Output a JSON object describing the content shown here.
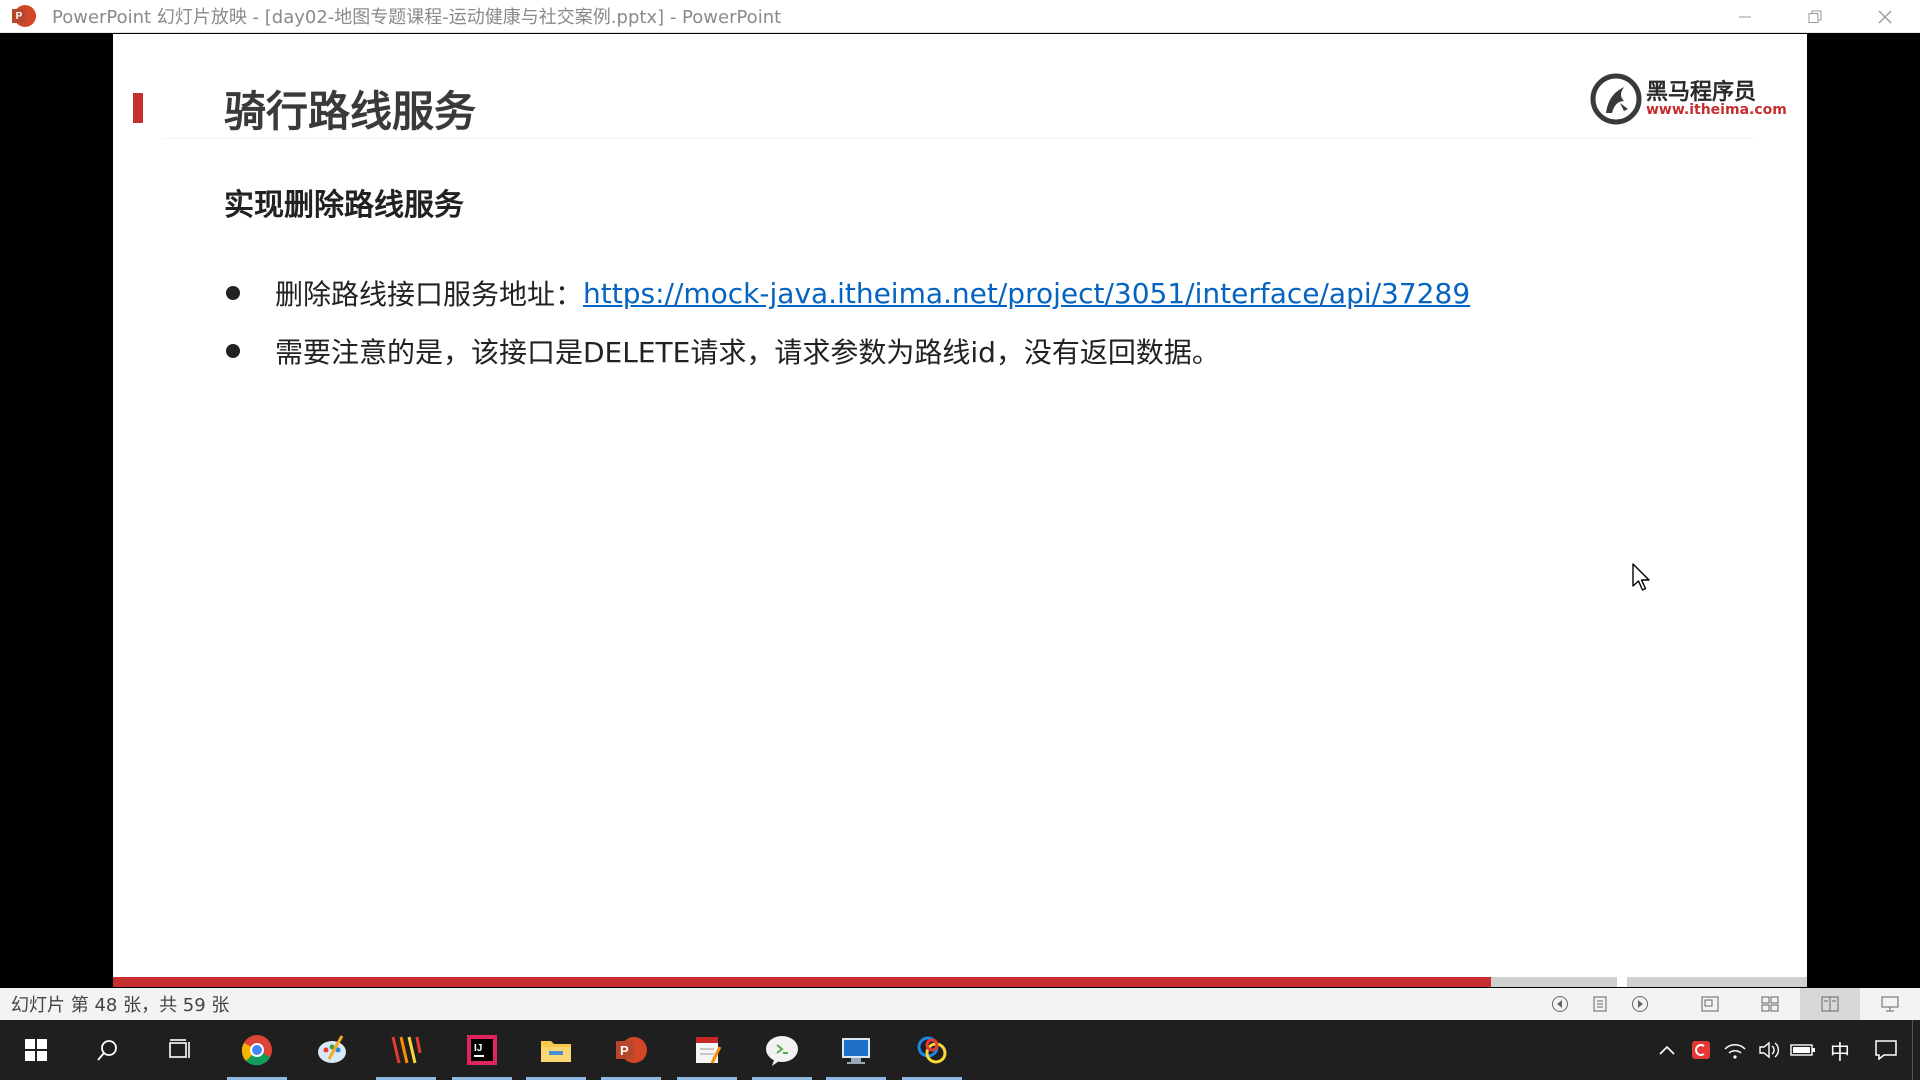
{
  "window": {
    "title": "PowerPoint 幻灯片放映 - [day02-地图专题课程-运动健康与社交案例.pptx] - PowerPoint",
    "app_icon": "powerpoint-icon",
    "app_icon_letter": "P"
  },
  "slide": {
    "title": "骑行路线服务",
    "subtitle": "实现删除路线服务",
    "brand_name": "黑马程序员",
    "brand_url": "www.itheima.com",
    "bullets": [
      {
        "prefix": "删除路线接口服务地址：",
        "link": "https://mock-java.itheima.net/project/3051/interface/api/37289"
      },
      {
        "text": "需要注意的是，该接口是DELETE请求，请求参数为路线id，没有返回数据。"
      }
    ],
    "progress_fraction": 0.8136
  },
  "status_bar": {
    "text": "幻灯片 第 48 张，共 59 张",
    "icons": [
      "previous-icon",
      "notes-icon",
      "next-icon",
      "normal-view-icon",
      "slide-sorter-icon",
      "reading-view-icon",
      "slideshow-icon"
    ]
  },
  "taskbar": {
    "apps": [
      "windows-start-icon",
      "search-icon",
      "task-view-icon",
      "chrome-icon",
      "paint-icon",
      "app-w-icon",
      "intellij-icon",
      "file-explorer-icon",
      "powerpoint-icon",
      "notes-app-icon",
      "wechat-icon",
      "remote-desktop-icon",
      "browser-icon"
    ],
    "tray": {
      "ime": "中",
      "icons": [
        "chevron-up-icon",
        "red-app-icon",
        "wifi-icon",
        "volume-icon",
        "battery-icon",
        "notification-icon"
      ]
    }
  },
  "colors": {
    "accent_red": "#c62f2f",
    "link_blue": "#0563c1",
    "taskbar": "#1f1f1f"
  }
}
